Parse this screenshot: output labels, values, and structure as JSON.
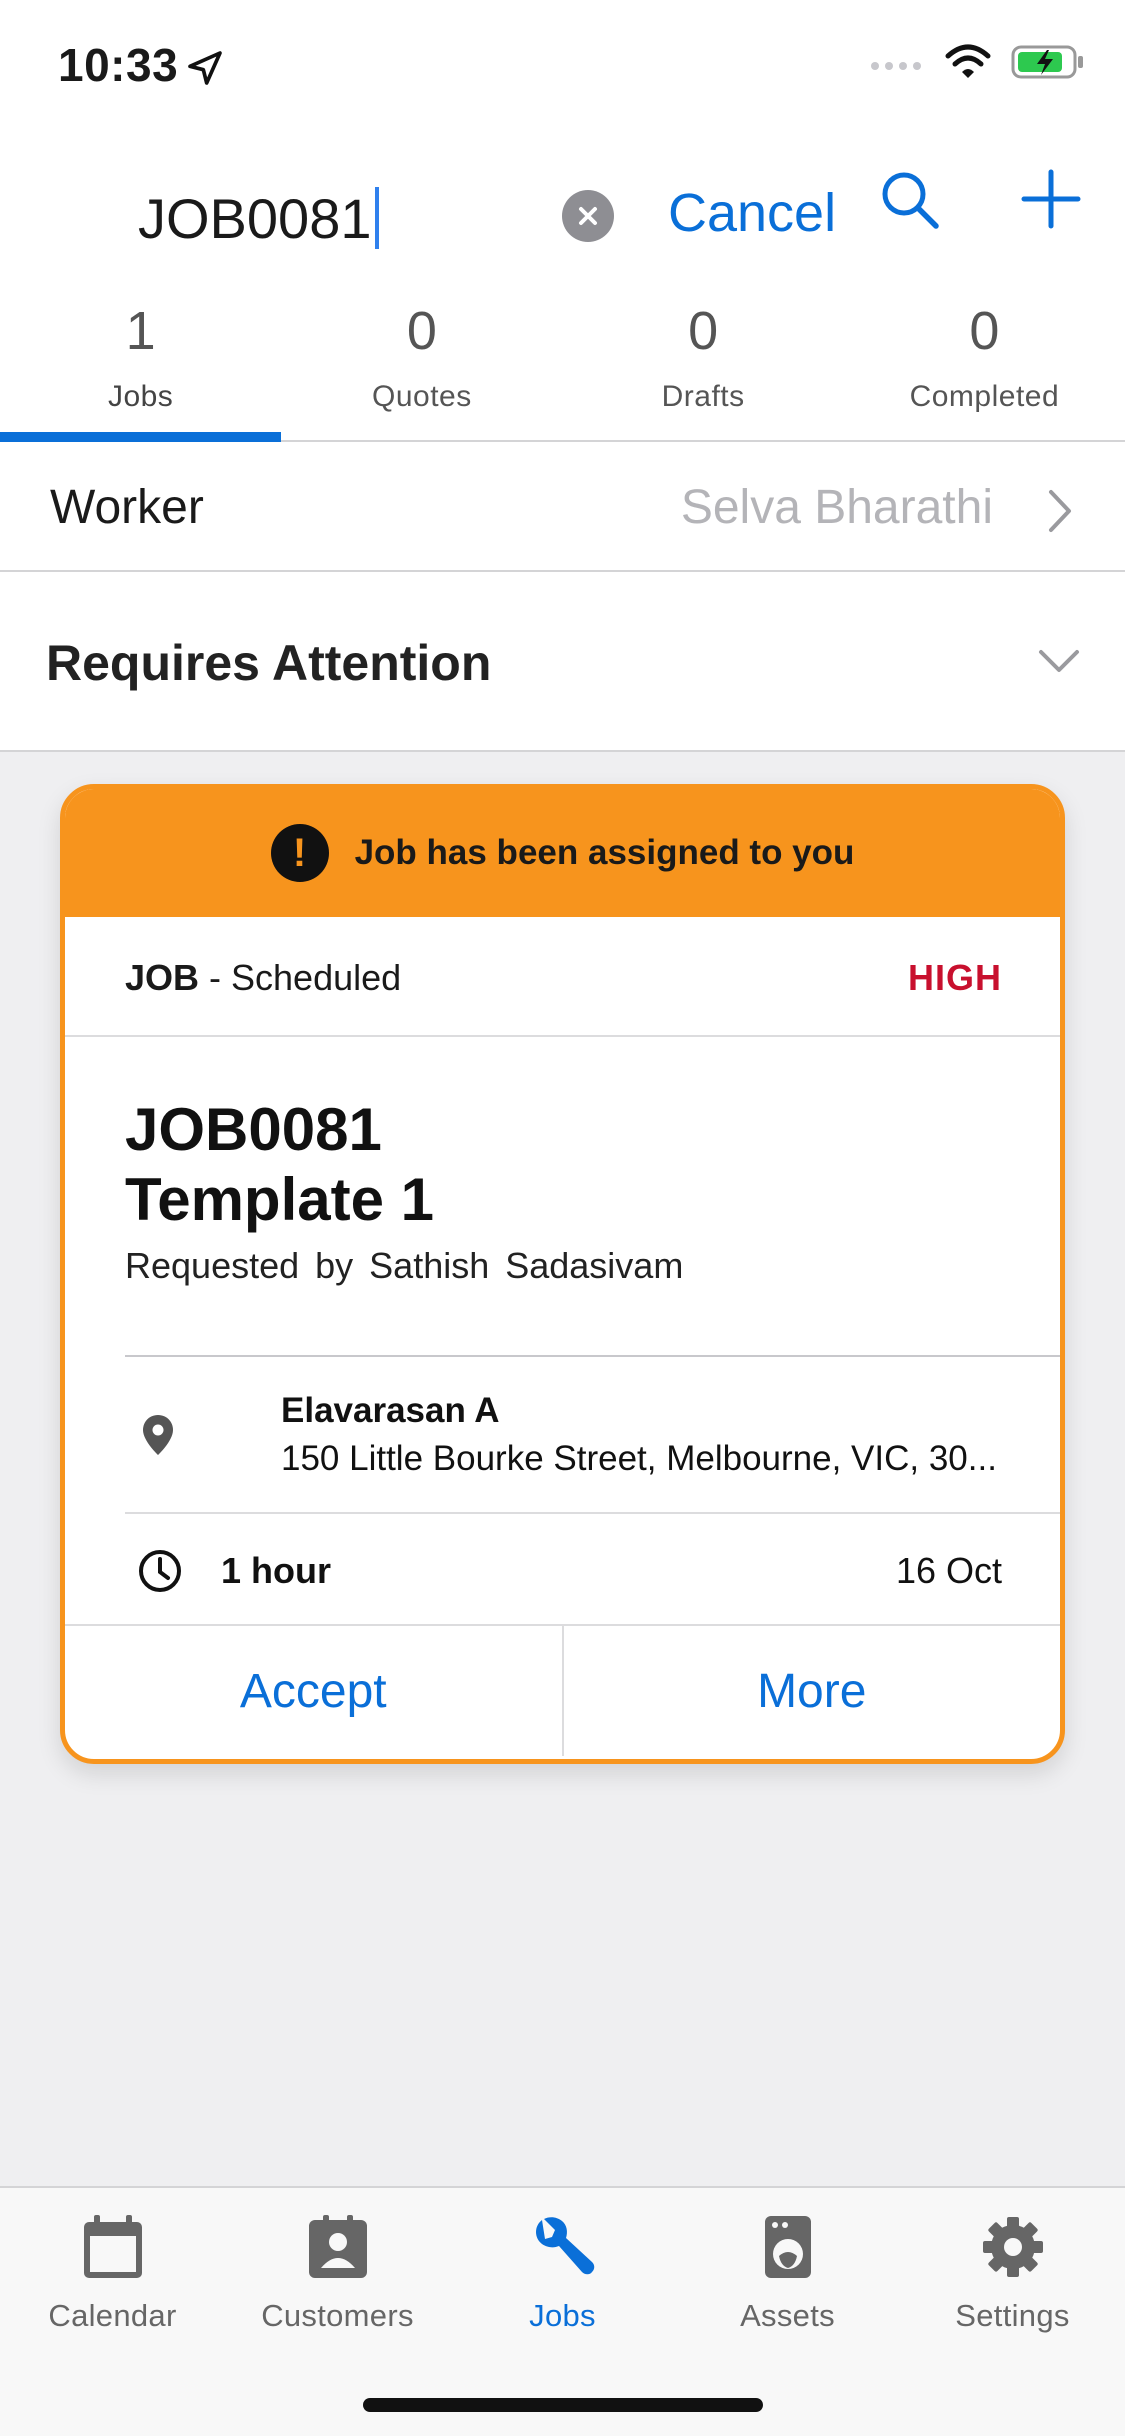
{
  "status_bar": {
    "time": "10:33",
    "icons": [
      "location-arrow-icon",
      "cellular-signal-icon",
      "wifi-icon",
      "battery-charging-icon"
    ]
  },
  "search": {
    "query": "JOB0081",
    "cancel_label": "Cancel",
    "icons": [
      "clear-icon",
      "search-icon",
      "plus-icon"
    ]
  },
  "tabs": [
    {
      "count": "1",
      "label": "Jobs",
      "active": true
    },
    {
      "count": "0",
      "label": "Quotes",
      "active": false
    },
    {
      "count": "0",
      "label": "Drafts",
      "active": false
    },
    {
      "count": "0",
      "label": "Completed",
      "active": false
    }
  ],
  "worker": {
    "label": "Worker",
    "value": "Selva Bharathi"
  },
  "attention": {
    "title": "Requires Attention"
  },
  "job_card": {
    "banner": "Job has been assigned to you",
    "type": "JOB",
    "status": " - Scheduled",
    "priority": "HIGH",
    "number": "JOB0081",
    "template": "Template 1",
    "requested_by": "Requested by  Sathish  Sadasivam",
    "location_name": "Elavarasan A",
    "address": "150 Little Bourke Street, Melbourne, VIC, 30...",
    "duration": "1 hour",
    "date": "16 Oct",
    "accept_label": "Accept",
    "more_label": "More",
    "accent_color": "#f7941d",
    "priority_color": "#c8102e"
  },
  "tab_bar": [
    {
      "label": "Calendar",
      "icon": "calendar-icon",
      "active": false
    },
    {
      "label": "Customers",
      "icon": "contact-card-icon",
      "active": false
    },
    {
      "label": "Jobs",
      "icon": "wrench-icon",
      "active": true
    },
    {
      "label": "Assets",
      "icon": "washing-machine-icon",
      "active": false
    },
    {
      "label": "Settings",
      "icon": "gear-icon",
      "active": false
    }
  ],
  "colors": {
    "accent": "#0a6fd8",
    "background": "#efeff1"
  }
}
